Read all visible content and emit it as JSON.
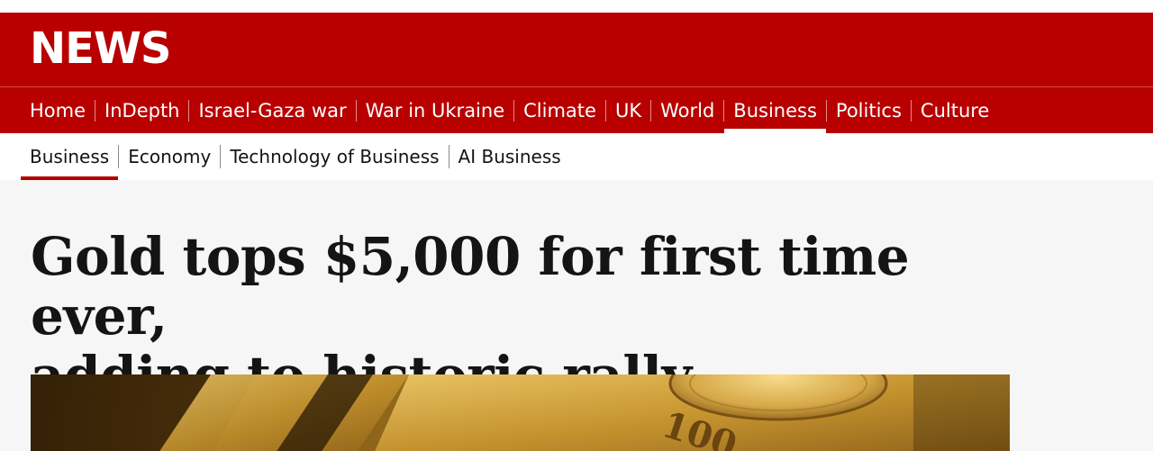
{
  "brand": {
    "logo_text": "NEWS",
    "accent_color": "#b80000"
  },
  "nav": {
    "items": [
      {
        "label": "Home"
      },
      {
        "label": "InDepth"
      },
      {
        "label": "Israel-Gaza war"
      },
      {
        "label": "War in Ukraine"
      },
      {
        "label": "Climate"
      },
      {
        "label": "UK"
      },
      {
        "label": "World"
      },
      {
        "label": "Business",
        "active": true
      },
      {
        "label": "Politics"
      },
      {
        "label": "Culture"
      }
    ]
  },
  "subnav": {
    "items": [
      {
        "label": "Business",
        "active": true
      },
      {
        "label": "Economy"
      },
      {
        "label": "Technology of Business"
      },
      {
        "label": "AI Business"
      }
    ]
  },
  "article": {
    "headline_line1": "Gold tops $5,000 for first time ever,",
    "headline_line2": "adding to historic rally",
    "hero_image": {
      "description_icon": "gold-bars-image",
      "stamp_text": "100"
    }
  }
}
